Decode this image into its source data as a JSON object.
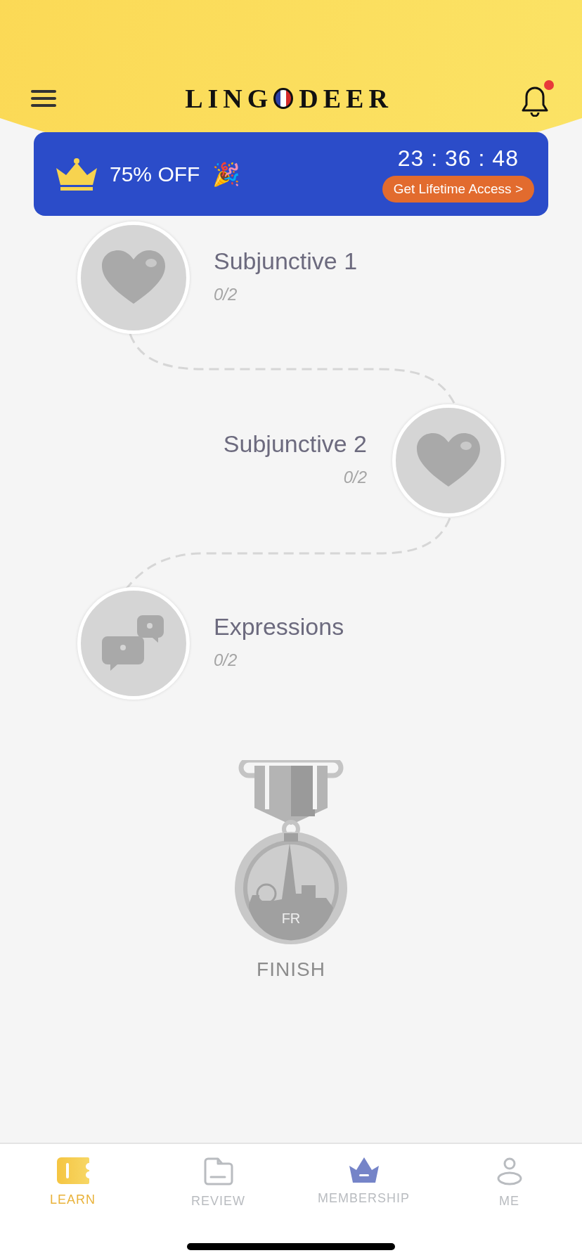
{
  "header": {
    "logo": [
      "LING",
      "DEER"
    ],
    "notification_dot": true
  },
  "promo": {
    "discount": "75% OFF",
    "emoji": "🎉",
    "timer": "23 : 36 : 48",
    "button": "Get Lifetime Access >"
  },
  "lessons": [
    {
      "kind": "heart",
      "title": "Subjunctive 1",
      "progress": "0/2"
    },
    {
      "kind": "heart",
      "title": "Subjunctive 2",
      "progress": "0/2"
    },
    {
      "kind": "chat",
      "title": "Expressions",
      "progress": "0/2"
    }
  ],
  "finish": {
    "badge": "FR",
    "label": "FINISH"
  },
  "tabs": [
    {
      "kind": "learn",
      "label": "LEARN",
      "selected": true
    },
    {
      "kind": "review",
      "label": "REVIEW",
      "selected": false
    },
    {
      "kind": "membership",
      "label": "MEMBERSHIP",
      "selected": false
    },
    {
      "kind": "me",
      "label": "ME",
      "selected": false
    }
  ]
}
